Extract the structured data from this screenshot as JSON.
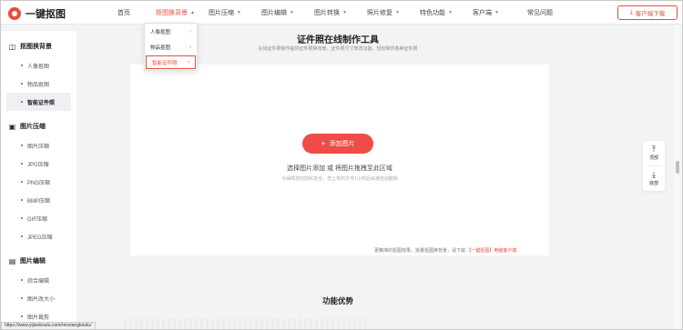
{
  "header": {
    "logo_text": "一键抠图",
    "nav": [
      {
        "label": "首页",
        "has_chev": false,
        "active": false
      },
      {
        "label": "抠图换背景",
        "has_chev": true,
        "active": true
      },
      {
        "label": "图片压缩",
        "has_chev": true,
        "active": false
      },
      {
        "label": "图片编辑",
        "has_chev": true,
        "active": false
      },
      {
        "label": "图片转换",
        "has_chev": true,
        "active": false
      },
      {
        "label": "照片修复",
        "has_chev": true,
        "active": false
      },
      {
        "label": "特色功能",
        "has_chev": true,
        "active": false
      },
      {
        "label": "客户端",
        "has_chev": true,
        "active": false
      },
      {
        "label": "常见问题",
        "has_chev": false,
        "active": false
      }
    ],
    "download_label": "客户端下载",
    "download_icon": "download-icon"
  },
  "dropdown": {
    "items": [
      "人像抠图",
      "物品抠图",
      "智能证件照"
    ],
    "highlighted": 2
  },
  "sidebar": {
    "groups": [
      {
        "title": "抠图换背景",
        "icon": "cutout-icon",
        "items": [
          "人像抠图",
          "物品抠图",
          "智能证件照"
        ],
        "active": 2
      },
      {
        "title": "图片压缩",
        "icon": "compress-icon",
        "items": [
          "图片压缩",
          "JPG压缩",
          "PNG压缩",
          "BMP压缩",
          "GIF压缩",
          "JPEG压缩"
        ],
        "active": -1
      },
      {
        "title": "图片编辑",
        "icon": "edit-icon",
        "items": [
          "综合编辑",
          "图片改大小",
          "图片裁剪"
        ],
        "active": -1
      }
    ]
  },
  "main": {
    "title": "证件照在线制作工具",
    "subtitle": "在线证件照制作提供证件照换背景、证件照尺寸修改功能，轻松制作各种证件照",
    "upload_button": "添加图片",
    "upload_tip": "选择图片添加 或 将图片拖拽至此区域",
    "upload_note": "为保障您的隐私安全，您上传的文件1小时后会被自动删除",
    "bottom_note_text": "更精准的抠图效果，批量抠图换背景，请下载",
    "bottom_note_link": "【一键抠图】电脑客户端",
    "advantage_title": "功能优势"
  },
  "float": {
    "top_label": "顶部",
    "bottom_label": "底部"
  },
  "status_url": "https://www.yijiankoutu.com/renxiangkoutu/",
  "colors": {
    "accent": "#e84c3d",
    "button": "#ef4b48"
  }
}
